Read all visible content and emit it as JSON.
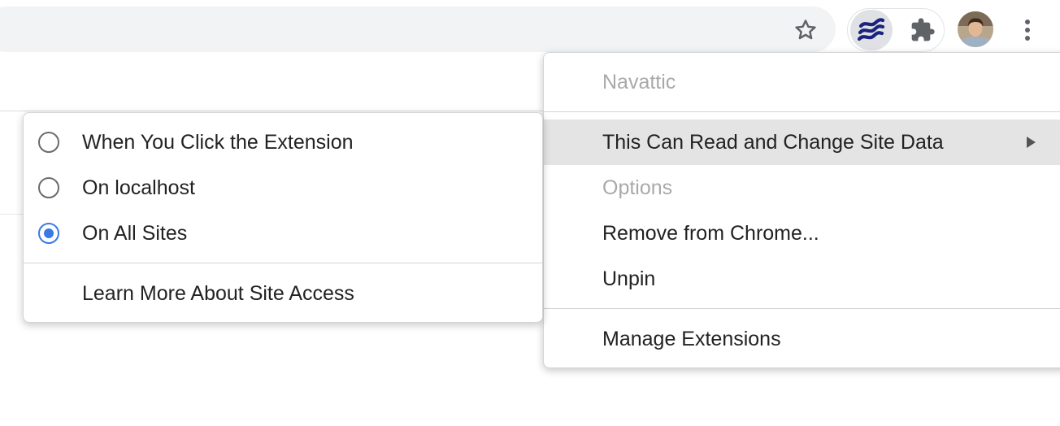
{
  "toolbar": {
    "icons": [
      "star-icon",
      "navattic-extension-icon",
      "puzzle-extensions-icon",
      "profile-avatar",
      "more-vert-icon"
    ],
    "accent": "#1a237e"
  },
  "context_menu": {
    "header": "Navattic",
    "items": [
      {
        "label": "This Can Read and Change Site Data",
        "highlighted": true,
        "has_submenu": true
      },
      {
        "label": "Options",
        "disabled": true
      },
      {
        "label": "Remove from Chrome..."
      },
      {
        "label": "Unpin"
      },
      {
        "label": "Manage Extensions"
      }
    ]
  },
  "site_access_submenu": {
    "options": [
      {
        "label": "When You Click the Extension",
        "checked": false
      },
      {
        "label": "On localhost",
        "checked": false
      },
      {
        "label": "On All Sites",
        "checked": true
      }
    ],
    "learn_more": "Learn More About Site Access"
  },
  "colors": {
    "radio_checked": "#3a7ae4",
    "highlight": "#e4e4e4",
    "disabled_text": "#a9a9a9"
  }
}
